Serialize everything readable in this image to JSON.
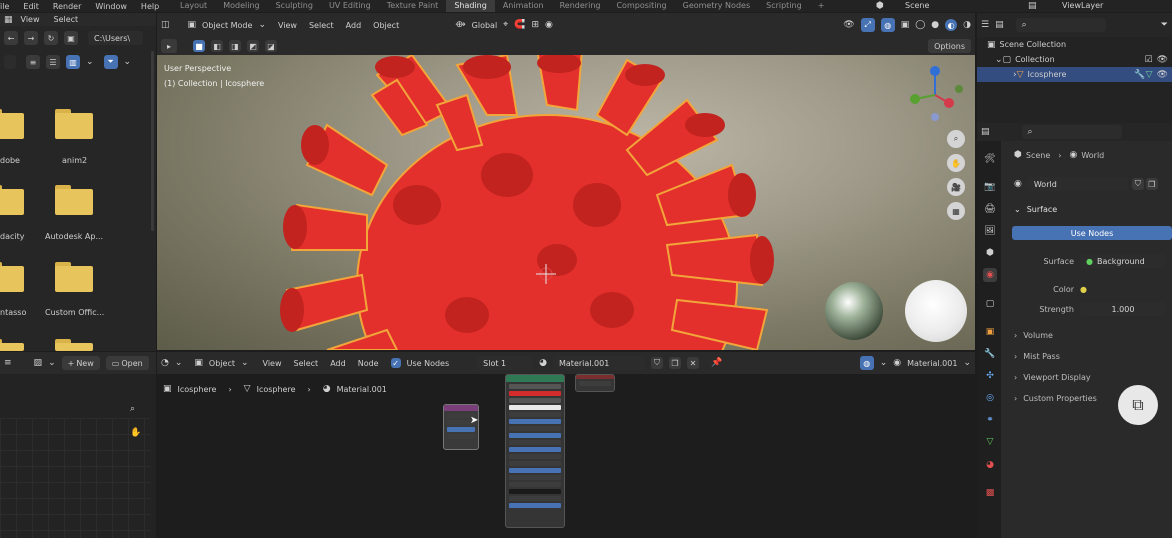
{
  "menu": [
    "File",
    "Edit",
    "Render",
    "Window",
    "Help"
  ],
  "workspace_tabs": [
    "Layout",
    "Modeling",
    "Sculpting",
    "UV Editing",
    "Texture Paint",
    "Shading",
    "Animation",
    "Rendering",
    "Compositing",
    "Geometry Nodes",
    "Scripting"
  ],
  "active_tab": "Shading",
  "scene_name": "Scene",
  "view_layer": "ViewLayer",
  "file_browser": {
    "menu": [
      "View",
      "Select"
    ],
    "path": "C:\\Users\\",
    "folders": [
      "dobe",
      "anim2",
      "dacity",
      "Autodesk Ap...",
      "ntasso",
      "Custom Offic..."
    ]
  },
  "viewport": {
    "mode": "Object Mode",
    "menu": [
      "View",
      "Select",
      "Add",
      "Object"
    ],
    "transform": "Global",
    "options_label": "Options",
    "info_line1": "User Perspective",
    "info_line2": "(1) Collection | Icosphere"
  },
  "outliner": {
    "scene_collection": "Scene Collection",
    "collection": "Collection",
    "object": "Icosphere"
  },
  "properties": {
    "breadcrumb_scene": "Scene",
    "breadcrumb_world": "World",
    "world_name": "World",
    "surface_panel": "Surface",
    "use_nodes": "Use Nodes",
    "surface_label": "Surface",
    "surface_value": "Background",
    "color_label": "Color",
    "strength_label": "Strength",
    "strength_value": "1.000",
    "panels": [
      "Volume",
      "Mist Pass",
      "Viewport Display",
      "Custom Properties"
    ]
  },
  "node_editor": {
    "type": "Object",
    "menu": [
      "View",
      "Select",
      "Add",
      "Node"
    ],
    "use_nodes": "Use Nodes",
    "slot": "Slot 1",
    "material": "Material.001",
    "material_right": "Material.001",
    "breadcrumbs": [
      "Icosphere",
      "Icosphere",
      "Material.001"
    ]
  },
  "image_editor": {
    "new_label": "New",
    "open_label": "Open"
  },
  "colors": {
    "accent": "#4772b3",
    "virus": "#e3302c",
    "outline": "#f2a53a"
  }
}
